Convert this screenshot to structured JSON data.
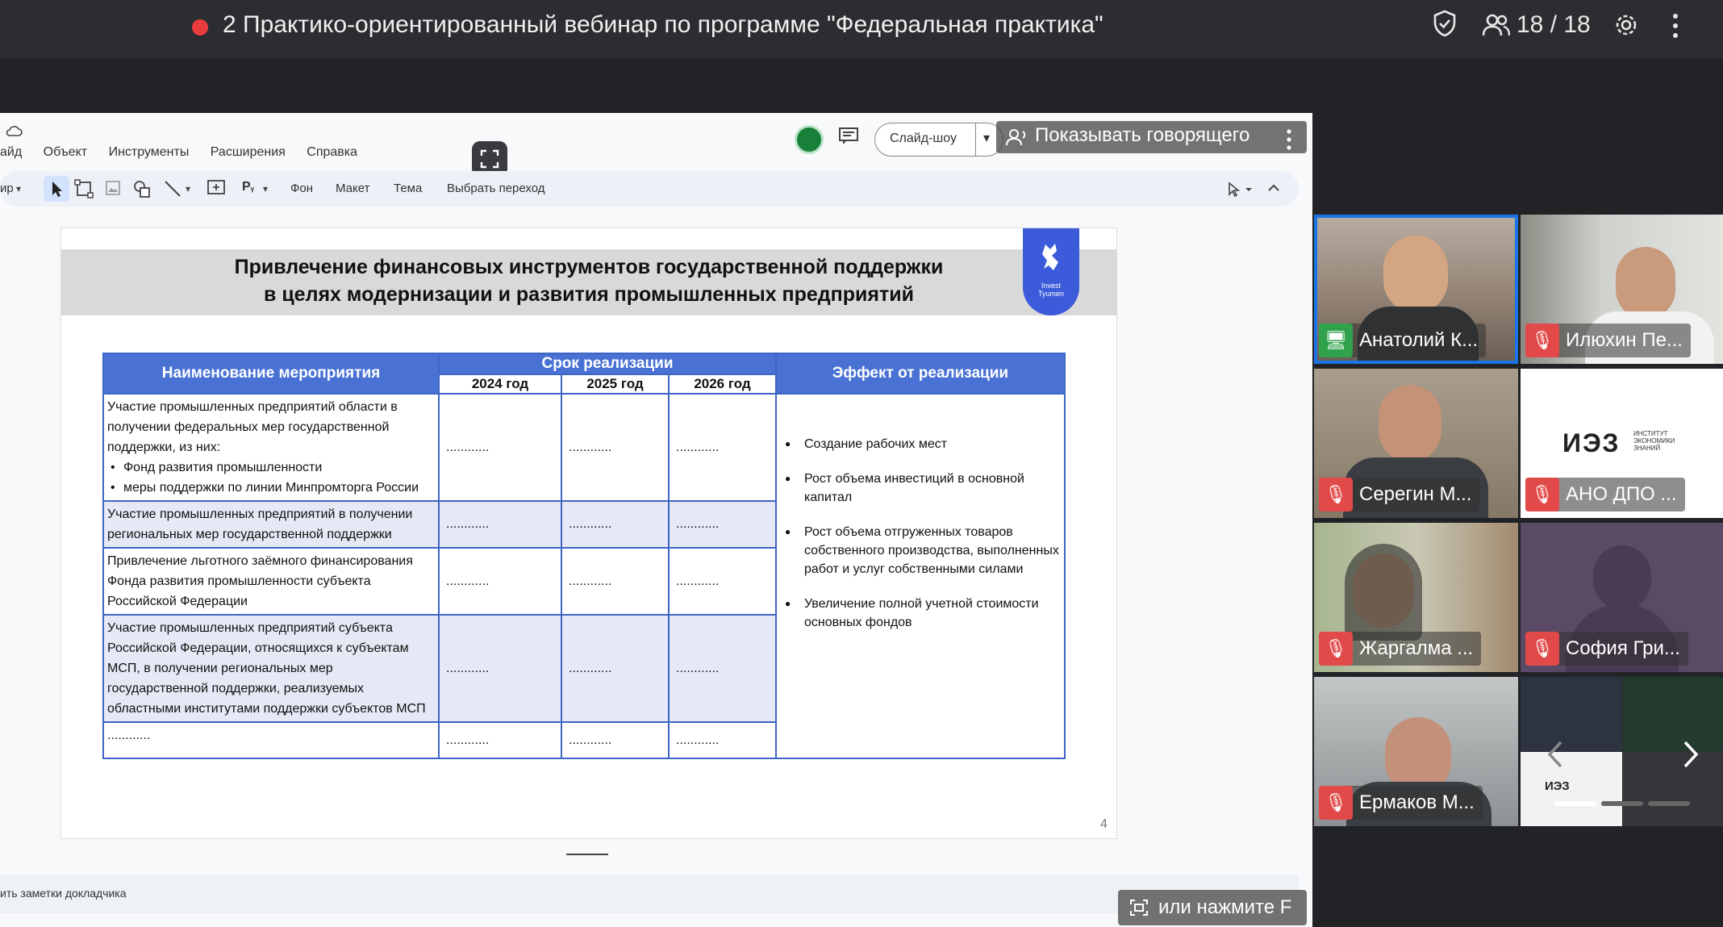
{
  "meeting": {
    "title": "2 Практико-ориентированный вебинар по программе \"Федеральная практика\"",
    "participants": "18 / 18"
  },
  "editor": {
    "menu": [
      "айд",
      "Объект",
      "Инструменты",
      "Расширения",
      "Справка"
    ],
    "toolbar": {
      "left_fragment": "ир",
      "background": "Фон",
      "layout": "Макет",
      "theme": "Тема",
      "transition": "Выбрать переход"
    },
    "slideshow_label": "Слайд-шоу",
    "speaker_toggle": "Показывать говорящего",
    "notes_label": "ить заметки докладчика",
    "fullscreen_hint": "или нажмите F"
  },
  "slide": {
    "title_line1": "Привлечение финансовых инструментов государственной поддержки",
    "title_line2": "в целях модернизации и развития промышленных предприятий",
    "logo_line1": "Invest",
    "logo_line2": "Tyumen",
    "page_number": "4",
    "table": {
      "header_activity": "Наименование мероприятия",
      "header_period": "Срок реализации",
      "header_effect": "Эффект от реализации",
      "years": [
        "2024 год",
        "2025 год",
        "2026 год"
      ],
      "rows": [
        {
          "activity": "Участие промышленных предприятий области в получении федеральных мер государственной поддержки, из них:",
          "bullets": [
            "Фонд развития промышленности",
            "меры поддержки по линии Минпромторга России"
          ],
          "values": [
            "............",
            "............",
            "............"
          ]
        },
        {
          "activity": "Участие промышленных предприятий в получении региональных мер государственной поддержки",
          "values": [
            "............",
            "............",
            "............"
          ]
        },
        {
          "activity": "Привлечение льготного заёмного финансирования Фонда развития промышленности субъекта Российской Федерации",
          "values": [
            "............",
            "............",
            "............"
          ]
        },
        {
          "activity": "Участие промышленных предприятий субъекта Российской Федерации, относящихся к субъектам МСП, в получении региональных мер государственной поддержки, реализуемых областными институтами поддержки субъектов МСП",
          "values": [
            "............",
            "............",
            "............"
          ]
        },
        {
          "activity": "............",
          "values": [
            "............",
            "............",
            "............"
          ]
        }
      ],
      "effects": [
        "Создание рабочих мест",
        "Рост объема инвестиций в основной капитал",
        "Рост объема отгруженных товаров собственного производства, выполненных работ и услуг собственными силами",
        "Увеличение полной учетной стоимости основных фондов"
      ]
    }
  },
  "participants": [
    {
      "name": "Анатолий К...",
      "status": "presenting"
    },
    {
      "name": "Илюхин Пе...",
      "status": "muted"
    },
    {
      "name": "Серегин М...",
      "status": "muted"
    },
    {
      "name": "АНО ДПО ...",
      "status": "muted"
    },
    {
      "name": "Жаргалма ...",
      "status": "muted"
    },
    {
      "name": "София Гри...",
      "status": "muted"
    },
    {
      "name": "Ермаков М...",
      "status": "muted"
    }
  ],
  "org_logo": {
    "mark": "ИЭЗ",
    "text_line1": "ИНСТИТУТ",
    "text_line2": "ЭКОНОМИКИ",
    "text_line3": "ЗНАНИЙ"
  },
  "colors": {
    "accent_blue": "#3c65c4",
    "muted_red": "#e24a4a",
    "active_border": "#1a73e8"
  }
}
